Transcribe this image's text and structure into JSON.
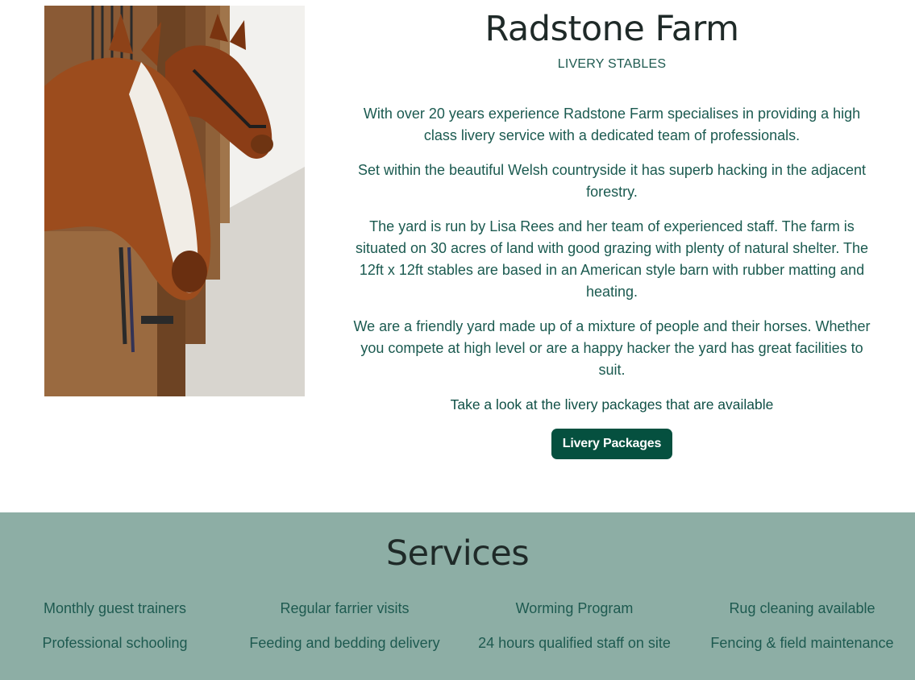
{
  "header": {
    "title": "Radstone Farm",
    "subtitle": "LIVERY STABLES"
  },
  "image": {
    "description_icon": "horses-in-stable-photo"
  },
  "intro": {
    "paragraphs": [
      "With over 20 years experience Radstone Farm specialises in providing a high class livery service with a dedicated team of professionals.",
      "Set within the beautiful Welsh countryside it has superb hacking in the adjacent forestry.",
      "The yard is run by Lisa Rees and her team of experienced staff. The farm is situated on 30 acres of land with good grazing with plenty of natural shelter. The 12ft x 12ft stables are based in an American style barn with rubber matting and heating.",
      "We are a friendly yard made up of a mixture of people and their horses. Whether you compete at high level or are a happy hacker the yard has great facilities to suit."
    ],
    "cta_text": "Take a look at the livery packages that are available",
    "cta_button": "Livery Packages"
  },
  "services": {
    "title": "Services",
    "items": [
      "Monthly guest trainers",
      "Regular farrier visits",
      "Worming Program",
      "Rug cleaning available",
      "Professional schooling",
      "Feeding and bedding delivery",
      "24 hours qualified staff on site",
      "Fencing & field maintenance"
    ]
  },
  "colors": {
    "brand_green": "#05503f",
    "text_green": "#1b5a50",
    "services_bg": "#8daea5"
  }
}
